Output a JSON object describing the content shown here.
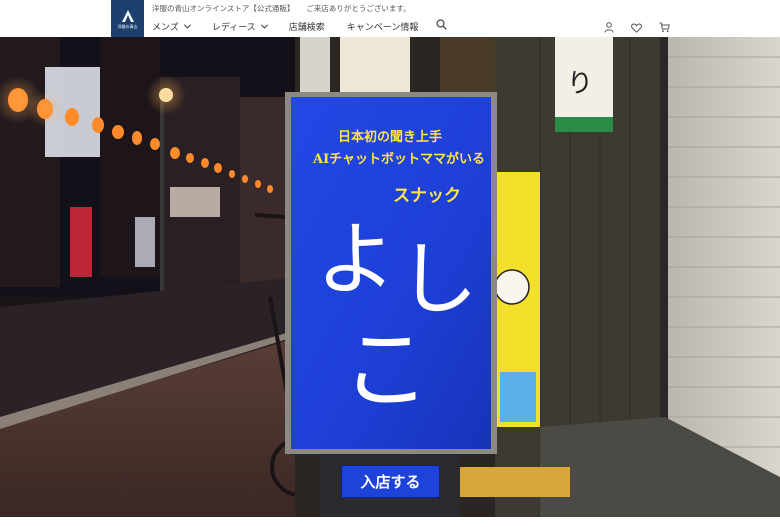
{
  "header": {
    "logo_text": "洋服の青山",
    "tagline": "洋服の青山オンラインストア【公式通販】",
    "welcome": "ご来店ありがとうございます。",
    "nav": [
      {
        "label": "メンズ",
        "dropdown": true
      },
      {
        "label": "レディース",
        "dropdown": true
      },
      {
        "label": "店舗検索",
        "dropdown": false
      },
      {
        "label": "キャンペーン情報",
        "dropdown": false
      }
    ],
    "icons": [
      "search-icon",
      "account-icon",
      "favorite-icon",
      "cart-icon"
    ]
  },
  "hero": {
    "sign_line1": "日本初の聞き上手",
    "sign_line2": "AIチャットボットママがいる",
    "sign_subtitle": "スナック",
    "sign_name_1": "よ",
    "sign_name_2": "し",
    "sign_name_3": "こ",
    "background_sign_text": "り",
    "cta_label": "入店する"
  },
  "colors": {
    "brand_navy": "#1c3f6e",
    "sign_blue": "#1d43d8",
    "sign_yellow": "#ffe34a",
    "side_sign_yellow": "#f3e02a"
  }
}
